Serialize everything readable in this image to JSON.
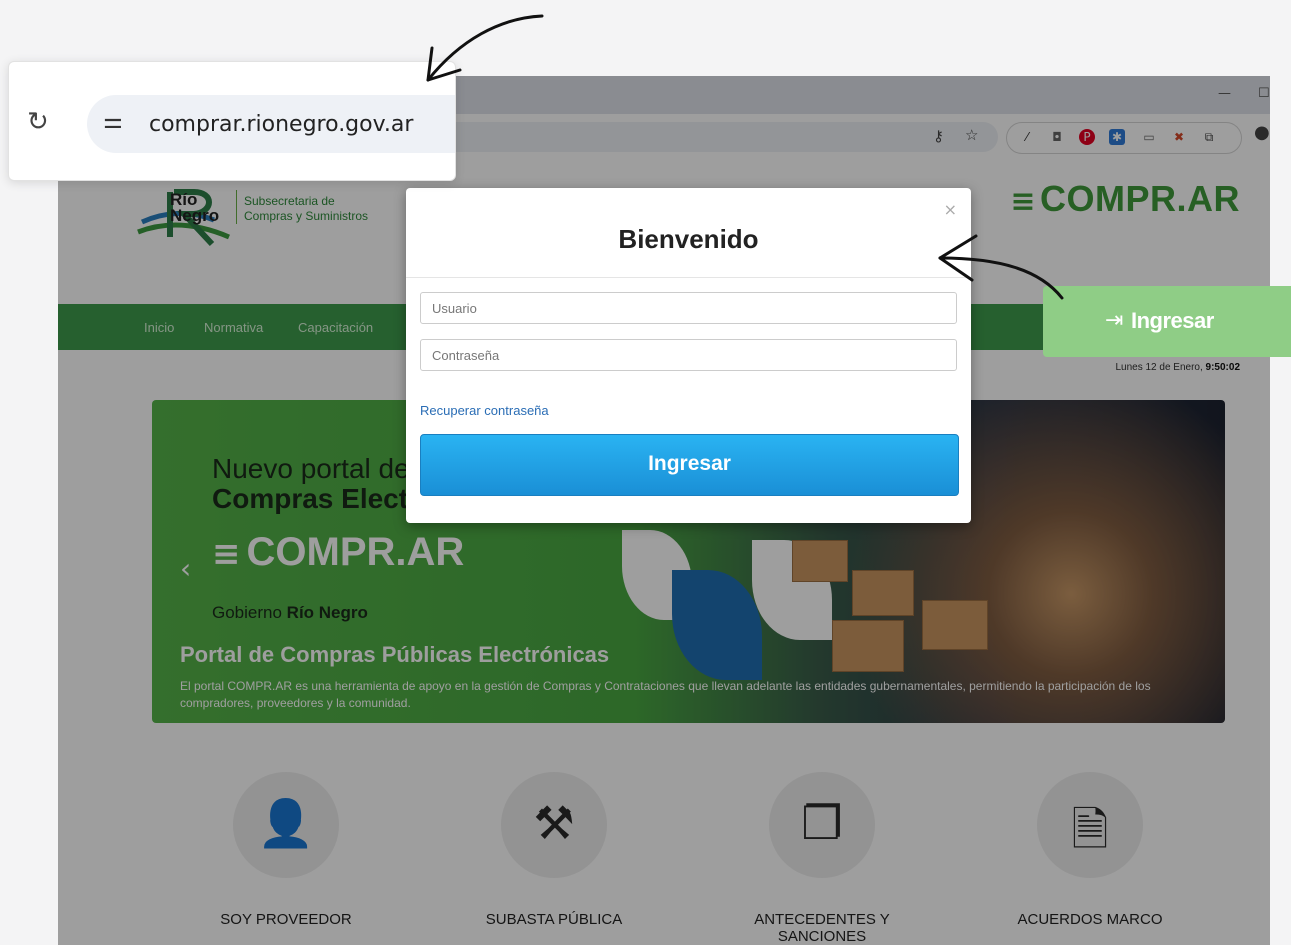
{
  "browser": {
    "url": "comprar.rionegro.gov.ar",
    "window_minimize": "—",
    "window_restore": "☐"
  },
  "site": {
    "brand": {
      "name_line1": "Río",
      "name_line2": "Negro",
      "sub_line1": "Subsecretaria de",
      "sub_line2": "Compras y Suministros"
    },
    "logo": "COMPR.AR",
    "nav": [
      "Inicio",
      "Normativa",
      "Capacitación"
    ],
    "datetime_prefix": "Lunes 12 de Enero, ",
    "datetime_time": "9:50:02",
    "login_button": "Ingresar",
    "banner": {
      "title_line1": "Nuevo portal de",
      "title_line2": "Compras Electrónicas",
      "logo": "COMPR.AR",
      "gob_prefix": "Gobierno ",
      "gob_bold": "Río Negro",
      "heading": "Portal de Compras Públicas Electrónicas",
      "description": "El portal COMPR.AR es una herramienta de apoyo en la gestión de Compras y Contrataciones que llevan adelante las entidades gubernamentales, permitiendo la participación de los compradores, proveedores y la comunidad."
    },
    "features": [
      {
        "label": "SOY PROVEEDOR",
        "icon": "user-icon"
      },
      {
        "label": "SUBASTA PÚBLICA",
        "icon": "gavel-icon"
      },
      {
        "label": "ANTECEDENTES Y SANCIONES",
        "icon": "documents-icon"
      },
      {
        "label": "ACUERDOS MARCO",
        "icon": "document-icon"
      }
    ]
  },
  "modal": {
    "title": "Bienvenido",
    "close": "×",
    "username_placeholder": "Usuario",
    "password_placeholder": "Contraseña",
    "recover_link": "Recuperar contraseña",
    "submit": "Ingresar"
  },
  "colors": {
    "accent_green": "#3e9b4c",
    "login_blue": "#1a8fd6",
    "callout_green": "#8fcd86"
  }
}
